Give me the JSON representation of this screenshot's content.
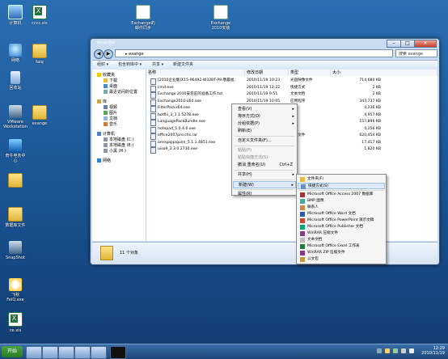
{
  "desktop": {
    "icons": [
      {
        "label": "计算机",
        "glyph": "pc"
      },
      {
        "label": "cccc.xls",
        "glyph": "xls"
      },
      {
        "label": "Exchange的\n邮件同步",
        "glyph": "doc"
      },
      {
        "label": "Exchange\n2010安装",
        "glyph": "doc"
      },
      {
        "label": "网络",
        "glyph": "net"
      },
      {
        "label": "faiq",
        "glyph": "folder"
      },
      {
        "label": "回收站",
        "glyph": "bin"
      },
      {
        "label": "VMware\nWorkstation",
        "glyph": "app"
      },
      {
        "label": "exange",
        "glyph": "folder"
      },
      {
        "label": "奇牛电务中\n心",
        "glyph": "shield"
      },
      {
        "label": "",
        "glyph": "folder"
      },
      {
        "label": "数据库文件",
        "glyph": "folder"
      },
      {
        "label": "SnapShot",
        "glyph": "app"
      },
      {
        "label": "飞秋\nFeiQ.exe",
        "glyph": "cloud"
      },
      {
        "label": "ce.xls",
        "glyph": "xls"
      }
    ]
  },
  "window": {
    "title": "exange",
    "address": "▸ exange",
    "search_placeholder": "搜索 exange",
    "toolbar": {
      "organize": "组织 ▾",
      "include": "包含到库中 ▾",
      "share": "共享 ▾",
      "newfolder": "新建文件夹"
    },
    "nav": [
      {
        "label": "收藏夹",
        "glyph": "star",
        "indent": 0
      },
      {
        "label": "下载",
        "glyph": "folder",
        "indent": 1
      },
      {
        "label": "桌面",
        "glyph": "desk",
        "indent": 1
      },
      {
        "label": "最近访问的位置",
        "glyph": "recent",
        "indent": 1
      },
      {
        "label": "库",
        "glyph": "lib",
        "indent": 0
      },
      {
        "label": "视频",
        "glyph": "video",
        "indent": 1
      },
      {
        "label": "图片",
        "glyph": "pic",
        "indent": 1
      },
      {
        "label": "文档",
        "glyph": "doc",
        "indent": 1
      },
      {
        "label": "音乐",
        "glyph": "music",
        "indent": 1
      },
      {
        "label": "计算机",
        "glyph": "pc",
        "indent": 0
      },
      {
        "label": "本地磁盘 (C:)",
        "glyph": "disk",
        "indent": 1
      },
      {
        "label": "本地磁盘 (E:)",
        "glyph": "disk",
        "indent": 1
      },
      {
        "label": "小黑 (H:)",
        "glyph": "disk",
        "indent": 1
      },
      {
        "label": "网络",
        "glyph": "net",
        "indent": 0
      }
    ],
    "columns": [
      "名称",
      "修改日期",
      "类型",
      "大小"
    ],
    "files": [
      {
        "name": "[2010企业版]X15-96492-W32BT-P9.哦最福..",
        "date": "2010/11/19 10:23",
        "type": "光盘映像文件",
        "size": "714,680 KB"
      },
      {
        "name": "cmd.exe",
        "date": "2010/11/19 12:22",
        "type": "快捷方式",
        "size": "2 KB"
      },
      {
        "name": "Exchange 2010安装前的准备工作.txt",
        "date": "2010/11/19 9:51",
        "type": "文本文档",
        "size": "2 KB"
      },
      {
        "name": "Exchange2010-x64.exe",
        "date": "2010/11/19 10:05",
        "type": "应用程序",
        "size": "347,737 KB"
      },
      {
        "name": "FilterPackx64.exe",
        "date": "",
        "type": "序",
        "size": "4,236 KB"
      },
      {
        "name": "hotfix_3_1.1.5278.exe",
        "date": "",
        "type": "序",
        "size": "4,957 KB"
      },
      {
        "name": "LanguagePackBundle.exe",
        "date": "",
        "type": "序",
        "size": "157,896 KB"
      },
      {
        "name": "notepad_5.0.4.0.exe",
        "date": "",
        "type": "序",
        "size": "4,256 KB"
      },
      {
        "name": "office2007pro.chs.rar",
        "date": "",
        "type": "压缩文件",
        "size": "620,454 KB"
      },
      {
        "name": "omegappiguim_5.1.1.4851.exe",
        "date": "",
        "type": "序",
        "size": "17,417 KB"
      },
      {
        "name": "uiso9_3.3.0.2730.exe",
        "date": "",
        "type": "序",
        "size": "1,820 KB"
      }
    ],
    "status": "11 个对象"
  },
  "context_menu": [
    {
      "label": "查看(V)",
      "arrow": true
    },
    {
      "label": "排序方式(O)",
      "arrow": true
    },
    {
      "label": "分组依据(P)",
      "arrow": true
    },
    {
      "label": "刷新(E)",
      "arrow": false
    },
    {
      "sep": true
    },
    {
      "label": "自定义文件夹(F)...",
      "arrow": false
    },
    {
      "sep": true
    },
    {
      "label": "粘贴(P)",
      "arrow": false,
      "disabled": true
    },
    {
      "label": "粘贴快捷方式(S)",
      "arrow": false,
      "disabled": true
    },
    {
      "label": "撤消 重命名(U)",
      "shortcut": "Ctrl+Z",
      "arrow": false
    },
    {
      "sep": true
    },
    {
      "label": "共享(H)",
      "arrow": true
    },
    {
      "sep": true
    },
    {
      "label": "新建(W)",
      "arrow": true,
      "highlight": true
    },
    {
      "sep": true
    },
    {
      "label": "属性(R)",
      "arrow": false
    }
  ],
  "submenu": [
    {
      "label": "文件夹(F)",
      "glyph": "folder"
    },
    {
      "label": "快捷方式(S)",
      "glyph": "shortcut",
      "highlight": true
    },
    {
      "sep": true
    },
    {
      "label": "Microsoft Office Access 2007 数据库",
      "glyph": "access"
    },
    {
      "label": "BMP 图像",
      "glyph": "bmp"
    },
    {
      "label": "联系人",
      "glyph": "contact"
    },
    {
      "label": "Microsoft Office Word 文档",
      "glyph": "word"
    },
    {
      "label": "Microsoft Office PowerPoint 演示文稿",
      "glyph": "ppt"
    },
    {
      "label": "Microsoft Office Publisher 文档",
      "glyph": "pub"
    },
    {
      "label": "WinRAR 压缩文件",
      "glyph": "rar"
    },
    {
      "label": "文本文档",
      "glyph": "txt"
    },
    {
      "label": "Microsoft Office Excel 工作表",
      "glyph": "excel"
    },
    {
      "label": "WinRAR ZIP 压缩文件",
      "glyph": "zip"
    },
    {
      "label": "公文包",
      "glyph": "brief"
    }
  ],
  "taskbar": {
    "start_label": "开始",
    "time": "12:29",
    "date": "2010/11/19"
  },
  "colors": {
    "accent": "#1b5494",
    "menu_highlight": "#dde9f7"
  }
}
